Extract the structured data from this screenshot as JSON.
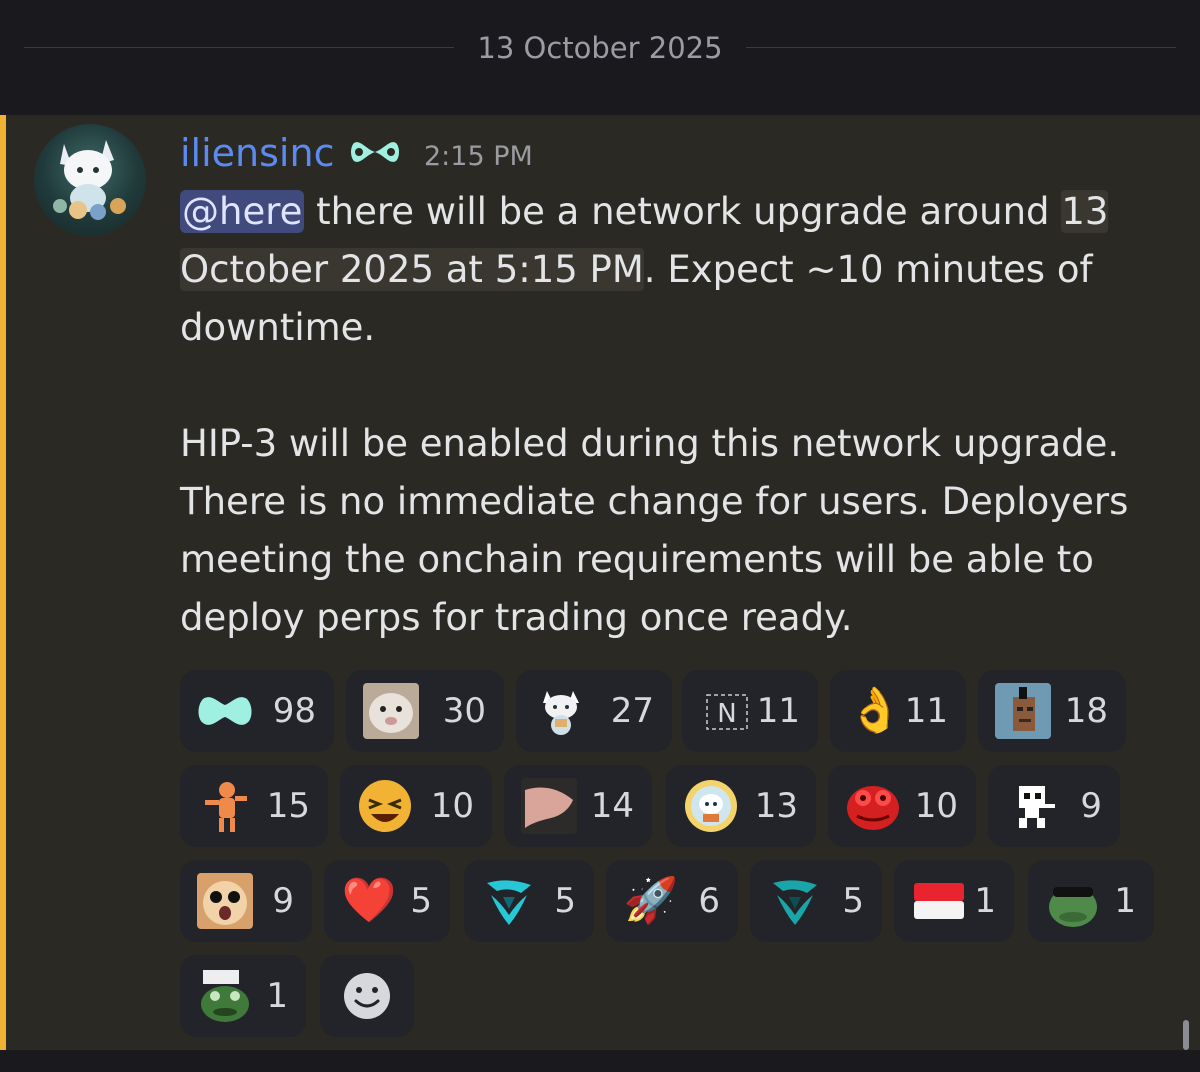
{
  "date_divider": "13 October 2025",
  "message": {
    "author": "iliensinc",
    "role_icon": "hyperliquid-glyph-icon",
    "timestamp": "2:15 PM",
    "mention": "@here",
    "line1_rest": " there will be a network upgrade around ",
    "event_time_a": "13",
    "event_time_b": "October 2025 at 5:15 PM",
    "line1_tail": ". Expect ~10 minutes of downtime.",
    "paragraph2": "HIP-3 will be enabled during this network upgrade. There is no immediate change for users. Deployers meeting the onchain requirements will be able to deploy perps for trading once ready."
  },
  "reactions": [
    {
      "emoji": "hyperliquid-blob",
      "count": "98"
    },
    {
      "emoji": "beluga-cat",
      "count": "30"
    },
    {
      "emoji": "cat-character",
      "count": "27"
    },
    {
      "emoji": "N-box",
      "count": "11"
    },
    {
      "emoji": "👌",
      "count": "11"
    },
    {
      "emoji": "punk-avatar",
      "count": "18"
    },
    {
      "emoji": "orange-dancer",
      "count": "15"
    },
    {
      "emoji": "laughing-face",
      "count": "10"
    },
    {
      "emoji": "hand-pinch",
      "count": "14"
    },
    {
      "emoji": "cat-badge",
      "count": "13"
    },
    {
      "emoji": "red-pepe",
      "count": "10"
    },
    {
      "emoji": "pixel-skull",
      "count": "9"
    },
    {
      "emoji": "shocked-cat",
      "count": "9"
    },
    {
      "emoji": "❤️",
      "count": "5"
    },
    {
      "emoji": "teal-logo",
      "count": "5"
    },
    {
      "emoji": "🚀",
      "count": "6"
    },
    {
      "emoji": "teal-logo-dark",
      "count": "5"
    },
    {
      "emoji": "🇮🇩",
      "count": "1"
    },
    {
      "emoji": "frog-sunglasses",
      "count": "1"
    },
    {
      "emoji": "frog-sign",
      "count": "1"
    }
  ],
  "colors": {
    "accent_bar": "#f0b232",
    "username": "#5b8af0",
    "mention_bg": "#414a7d",
    "reaction_bg": "#23242a"
  }
}
